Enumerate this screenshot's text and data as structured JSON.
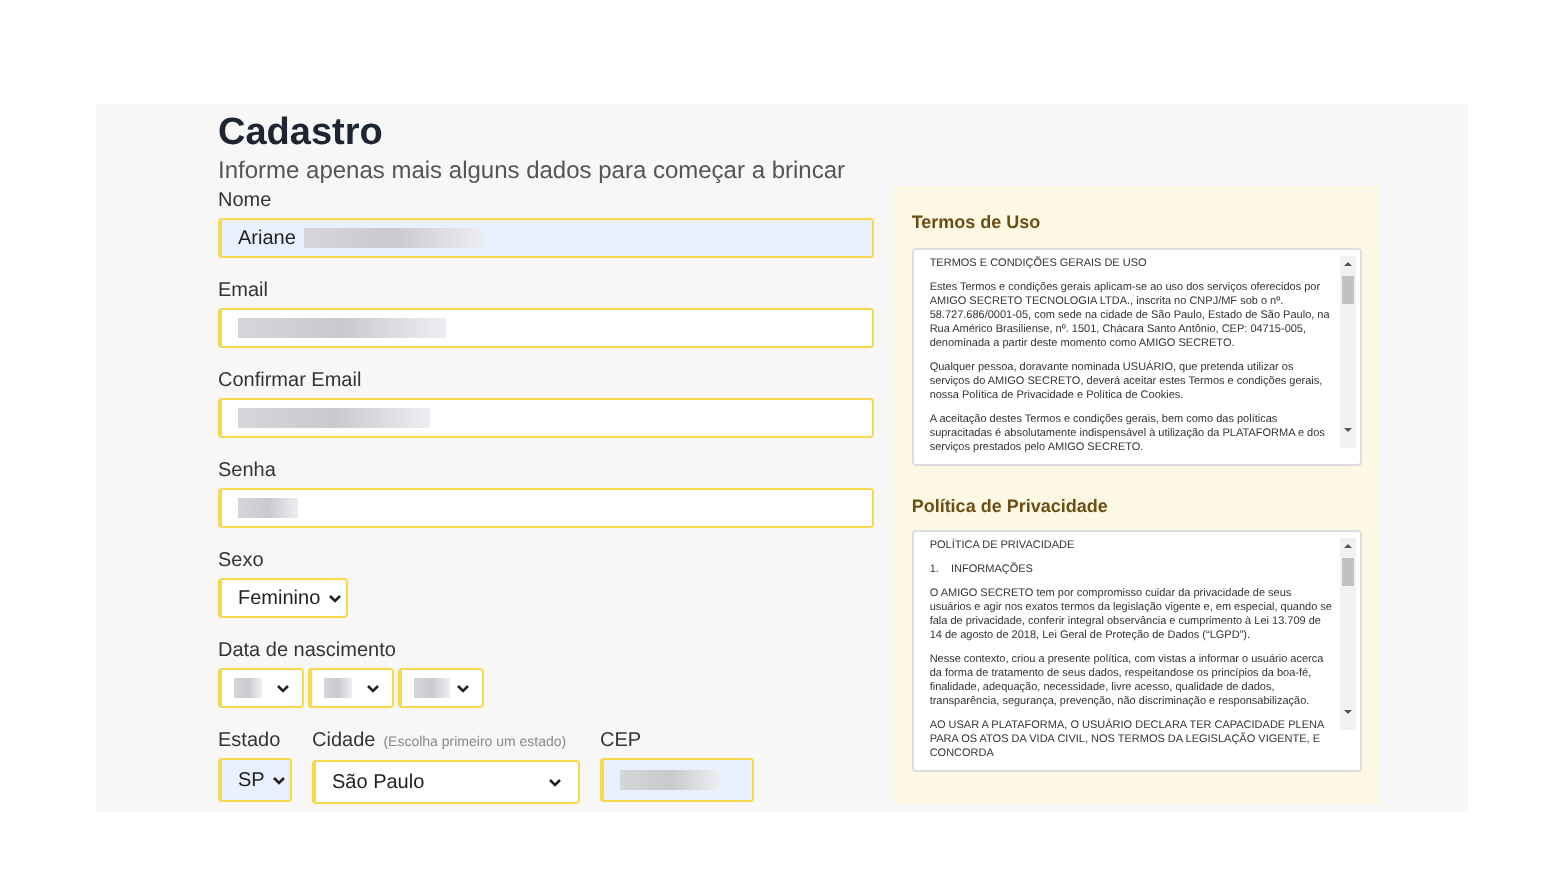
{
  "form": {
    "title": "Cadastro",
    "subtitle": "Informe apenas mais alguns dados para começar a brincar",
    "fields": [
      {
        "kind": "text",
        "label": "Nome",
        "value": "Ariane",
        "redacted": true,
        "autofilled": true
      },
      {
        "kind": "text",
        "label": "Email",
        "redacted": true,
        "autofilled": false
      },
      {
        "kind": "text",
        "label": "Confirmar Email",
        "redacted": true,
        "autofilled": false
      },
      {
        "kind": "text",
        "label": "Senha",
        "redacted": true,
        "autofilled": false
      },
      {
        "kind": "select",
        "label": "Sexo",
        "value": "Feminino"
      },
      {
        "kind": "date",
        "label": "Data de nascimento",
        "parts": [
          {
            "redacted": true
          },
          {
            "redacted": true
          },
          {
            "redacted": true
          }
        ]
      }
    ],
    "location": [
      {
        "kind": "select",
        "label": "Estado",
        "value": "SP",
        "autofilled": true
      },
      {
        "kind": "select",
        "label": "Cidade",
        "hint": "(Escolha primeiro um estado)",
        "value": "São Paulo",
        "autofilled": false
      },
      {
        "kind": "text",
        "label": "CEP",
        "redacted": true,
        "autofilled": true
      }
    ]
  },
  "documents": [
    {
      "title": "Termos de Uso",
      "paragraphs": [
        "TERMOS E CONDIÇÕES GERAIS DE USO",
        "Estes Termos e condições gerais aplicam-se ao uso dos serviços oferecidos por AMIGO SECRETO TECNOLOGIA LTDA., inscrita no CNPJ/MF sob o nº. 58.727.686/0001-05, com sede na cidade de São Paulo, Estado de São Paulo, na Rua Américo Brasiliense, nº. 1501, Chácara Santo Antônio, CEP: 04715-005, denominada a partir deste momento como AMIGO SECRETO.",
        "Qualquer pessoa, doravante nominada USUÁRIO, que pretenda utilizar os serviços do AMIGO SECRETO, deverá aceitar estes Termos e condições gerais, nossa Política de Privacidade e Política de Cookies.",
        "A aceitação destes Termos e condições gerais, bem como das políticas supracitadas é absolutamente indispensável à utilização da PLATAFORMA e dos serviços prestados pelo AMIGO SECRETO."
      ]
    },
    {
      "title": "Política de Privacidade",
      "paragraphs": [
        "POLÍTICA DE PRIVACIDADE",
        "1.    INFORMAÇÕES",
        "O AMIGO SECRETO tem por compromisso cuidar da privacidade de seus usuários e agir nos exatos termos da legislação vigente e, em especial, quando se fala de privacidade, conferir integral observância e cumprimento à Lei 13.709 de 14 de agosto de 2018, Lei Geral de Proteção de Dados (“LGPD”).",
        "Nesse contexto, criou a presente política, com vistas a informar o usuário acerca da forma de tratamento de seus dados, respeitandose os princípios da boa-fé, finalidade, adequação, necessidade, livre acesso, qualidade de dados, transparência, segurança, prevenção, não discriminação e responsabilização.",
        "AO USAR A PLATAFORMA, O USUÁRIO DECLARA TER CAPACIDADE PLENA PARA OS ATOS DA VIDA CIVIL, NOS TERMOS DA LEGISLAÇÃO VIGENTE, E CONCORDA"
      ]
    }
  ]
}
